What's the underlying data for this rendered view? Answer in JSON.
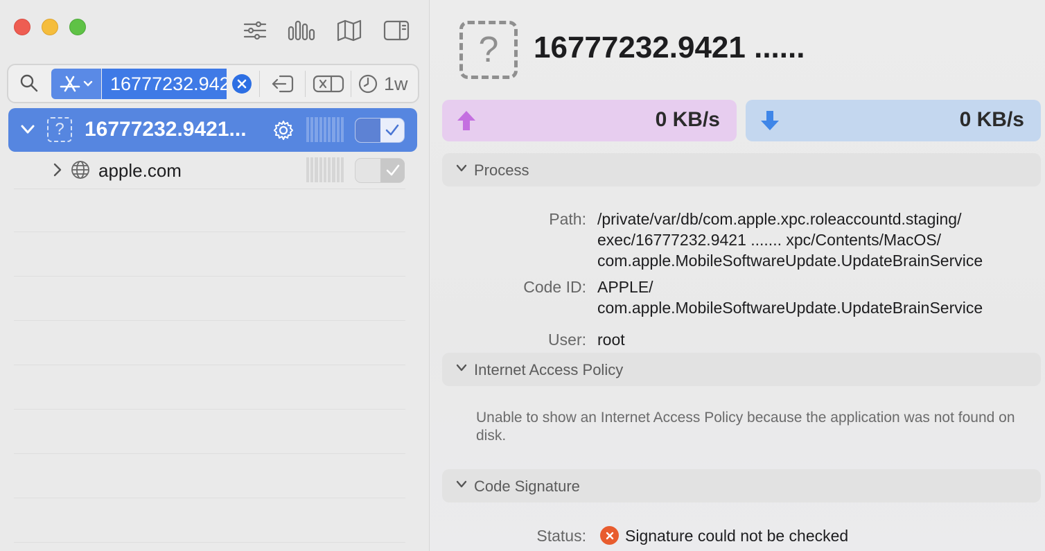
{
  "sidebar": {
    "filter": {
      "value": "16777232.942",
      "time_range": "1w"
    },
    "rows": [
      {
        "title": "16777232.9421...",
        "expanded": true,
        "selected": true,
        "enabled": true
      },
      {
        "label": "apple.com",
        "expanded": false,
        "selected": false,
        "enabled": true
      }
    ]
  },
  "detail": {
    "title": "16777232.9421 ......",
    "icon_glyph": "?",
    "upload_rate": "0 KB/s",
    "download_rate": "0 KB/s",
    "process": {
      "header": "Process",
      "path_label": "Path:",
      "path_lines": [
        "/private/var/db/com.apple.xpc.roleaccountd.staging/",
        "exec/16777232.9421 .......  xpc/Contents/MacOS/",
        "com.apple.MobileSoftwareUpdate.UpdateBrainService"
      ],
      "code_id_label": "Code ID:",
      "code_id_lines": [
        "APPLE/",
        "com.apple.MobileSoftwareUpdate.UpdateBrainService"
      ],
      "user_label": "User:",
      "user": "root"
    },
    "policy": {
      "header": "Internet Access Policy",
      "message": "Unable to show an Internet Access Policy because the application was not found on disk."
    },
    "signature": {
      "header": "Code Signature",
      "status_label": "Status:",
      "status": "Signature could not be checked"
    }
  },
  "colors": {
    "selection": "#5686e0",
    "upload_bg": "#e7cdef",
    "download_bg": "#c4d7ef",
    "upload_arrow": "#c46fe0",
    "download_arrow": "#3f86e8",
    "error": "#e85c2e"
  }
}
